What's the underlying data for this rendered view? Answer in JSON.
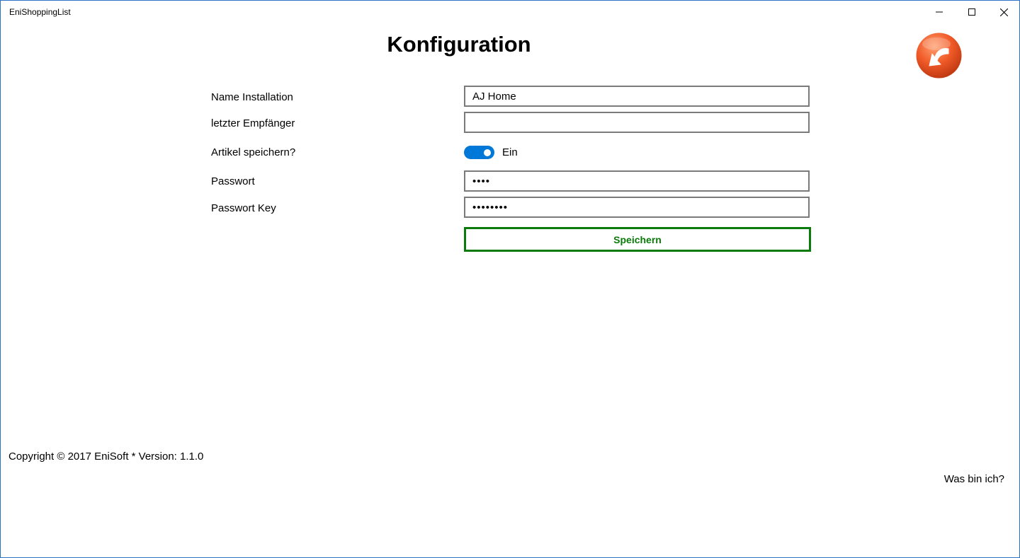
{
  "window": {
    "title": "EniShoppingList",
    "accent_color": "#2b73c7"
  },
  "page": {
    "title": "Konfiguration",
    "back_icon": "back-arrow-icon",
    "back_icon_color": "#f05a28"
  },
  "form": {
    "name_label": "Name Installation",
    "name_value": "AJ Home",
    "recipient_label": "letzter Empfänger",
    "recipient_value": "",
    "save_items_label": "Artikel speichern?",
    "save_items_state": "Ein",
    "save_items_on": true,
    "toggle_color": "#0078d7",
    "password_label": "Passwort",
    "password_value": "abcd",
    "password_key_label": "Passwort Key",
    "password_key_value": "abcdefgh",
    "save_button_label": "Speichern",
    "save_button_color": "#0a7a0a"
  },
  "footer": {
    "copyright": "Copyright © 2017 EniSoft * Version: 1.1.0",
    "about_link": "Was bin ich?"
  }
}
